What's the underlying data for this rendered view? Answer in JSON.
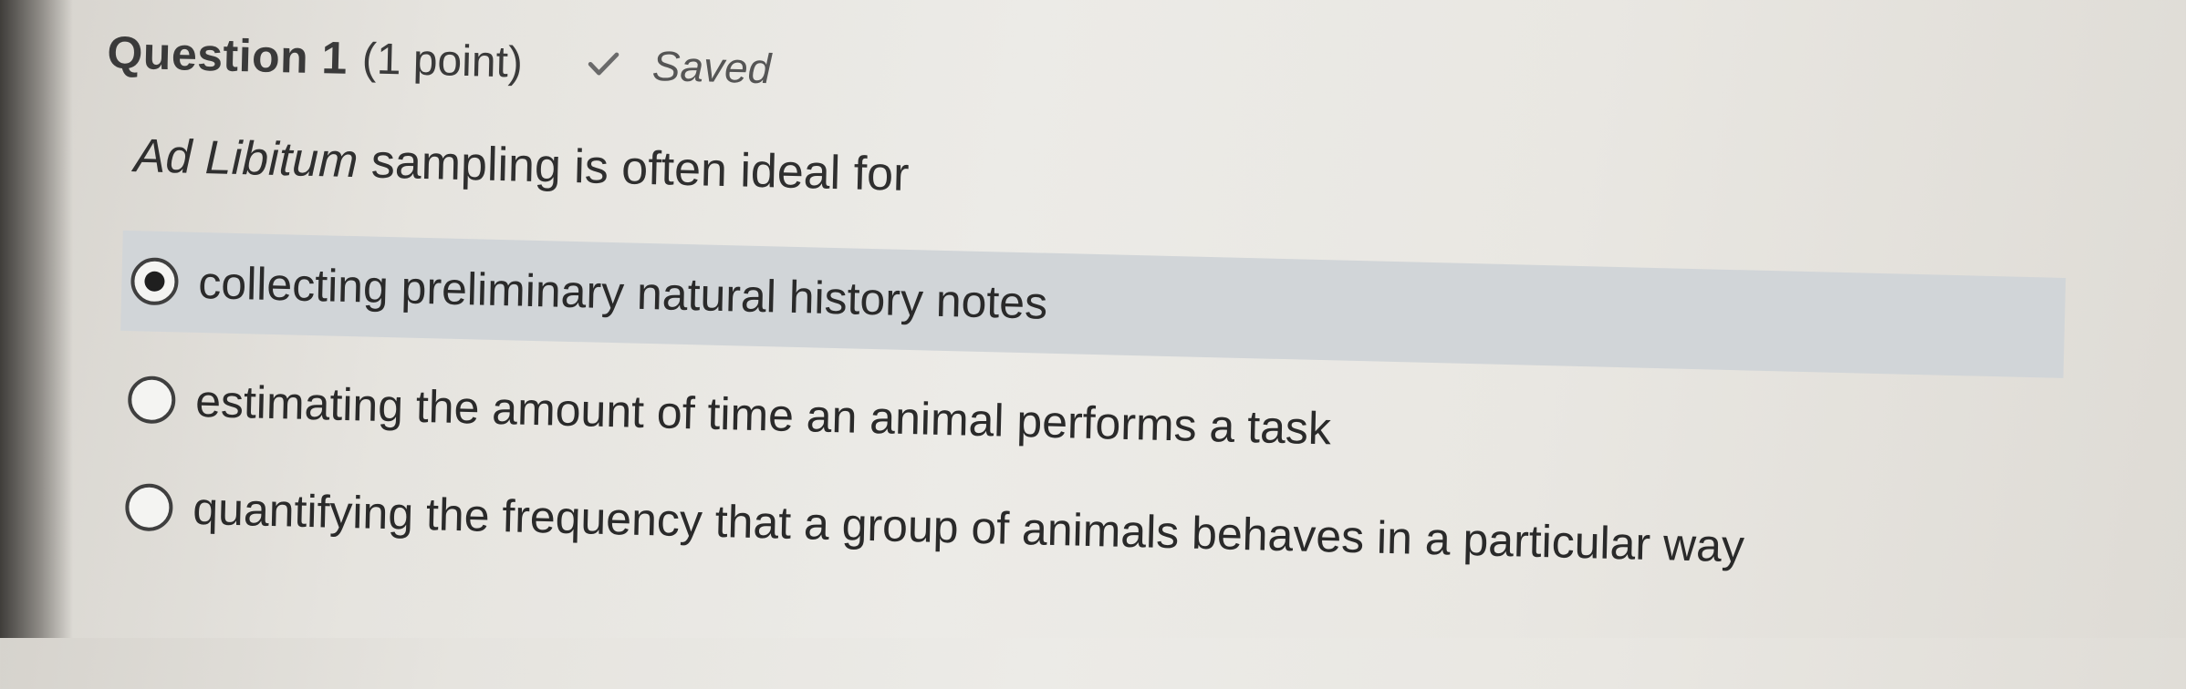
{
  "question": {
    "title": "Question 1",
    "points": "(1 point)",
    "status": "Saved",
    "status_icon": "check-icon",
    "prompt_italic": "Ad Libitum",
    "prompt_rest": " sampling is often ideal for"
  },
  "options": [
    {
      "label": "collecting preliminary natural history notes",
      "selected": true
    },
    {
      "label": "estimating the amount of time an animal performs a task",
      "selected": false
    },
    {
      "label": "quantifying the frequency that a group of animals behaves in a particular way",
      "selected": false
    }
  ],
  "colors": {
    "selected_background": "#d1d5d8",
    "text": "#2b2b2b"
  }
}
